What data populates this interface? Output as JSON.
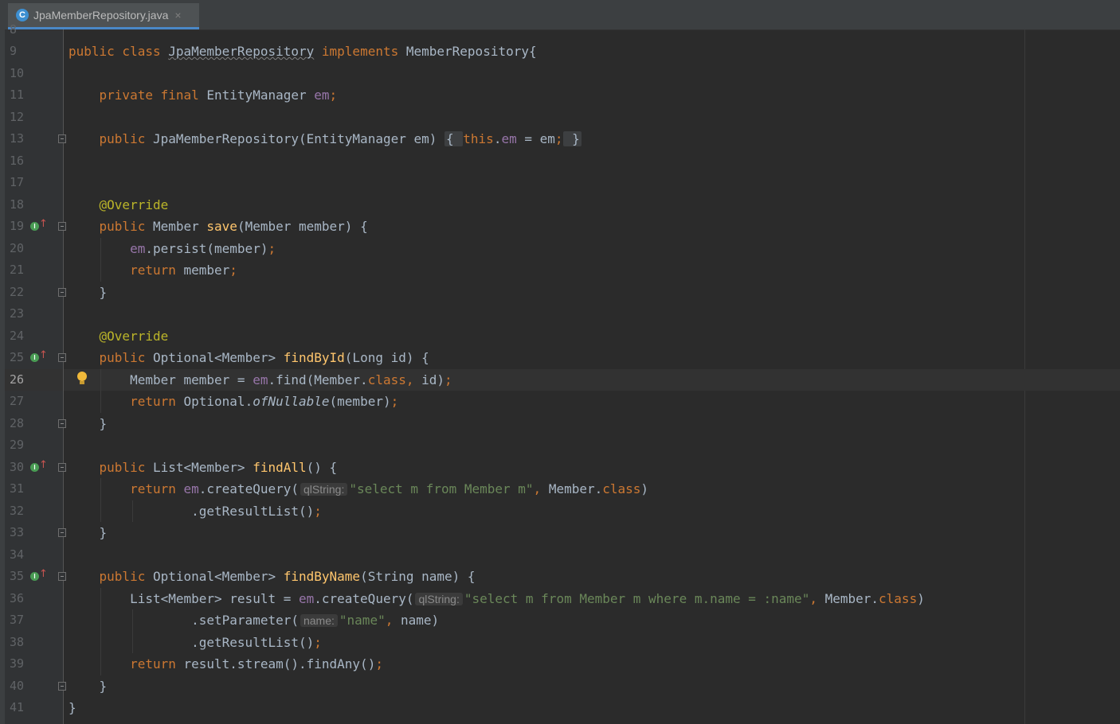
{
  "tab": {
    "icon_letter": "C",
    "file_name": "JpaMemberRepository.java",
    "close_glyph": "×"
  },
  "top_partial_line_number": "8",
  "lines": [
    {
      "n": "9",
      "segments": [
        [
          "kw",
          "public class "
        ],
        [
          "warn",
          "JpaMemberRepository"
        ],
        [
          "kw",
          " implements "
        ],
        [
          "d",
          "MemberRepository{"
        ]
      ]
    },
    {
      "n": "10",
      "segments": []
    },
    {
      "n": "11",
      "segments": [
        [
          "d",
          "    "
        ],
        [
          "kw",
          "private final "
        ],
        [
          "d",
          "EntityManager "
        ],
        [
          "fld",
          "em"
        ],
        [
          "kw",
          ";"
        ]
      ]
    },
    {
      "n": "12",
      "segments": []
    },
    {
      "n": "13",
      "segments": [
        [
          "d",
          "    "
        ],
        [
          "kw",
          "public "
        ],
        [
          "d",
          "JpaMemberRepository(EntityManager em) "
        ],
        [
          "fold",
          "{ "
        ],
        [
          "kw",
          "this"
        ],
        [
          "d",
          "."
        ],
        [
          "fld",
          "em"
        ],
        [
          "d",
          " = em"
        ],
        [
          "kw",
          ";"
        ],
        [
          "fold",
          " }"
        ]
      ]
    },
    {
      "n": "16",
      "segments": []
    },
    {
      "n": "17",
      "segments": []
    },
    {
      "n": "18",
      "segments": [
        [
          "d",
          "    "
        ],
        [
          "ann",
          "@Override"
        ]
      ]
    },
    {
      "n": "19",
      "segments": [
        [
          "d",
          "    "
        ],
        [
          "kw",
          "public "
        ],
        [
          "d",
          "Member "
        ],
        [
          "fn",
          "save"
        ],
        [
          "d",
          "(Member member) {"
        ]
      ]
    },
    {
      "n": "20",
      "segments": [
        [
          "d",
          "        "
        ],
        [
          "fld",
          "em"
        ],
        [
          "d",
          ".persist(member)"
        ],
        [
          "kw",
          ";"
        ]
      ]
    },
    {
      "n": "21",
      "segments": [
        [
          "d",
          "        "
        ],
        [
          "kw",
          "return "
        ],
        [
          "d",
          "member"
        ],
        [
          "kw",
          ";"
        ]
      ]
    },
    {
      "n": "22",
      "segments": [
        [
          "d",
          "    }"
        ]
      ]
    },
    {
      "n": "23",
      "segments": []
    },
    {
      "n": "24",
      "segments": [
        [
          "d",
          "    "
        ],
        [
          "ann",
          "@Override"
        ]
      ]
    },
    {
      "n": "25",
      "segments": [
        [
          "d",
          "    "
        ],
        [
          "kw",
          "public "
        ],
        [
          "d",
          "Optional<Member> "
        ],
        [
          "fn",
          "findById"
        ],
        [
          "d",
          "(Long id) {"
        ]
      ]
    },
    {
      "n": "26",
      "segments": [
        [
          "d",
          "        Member member = "
        ],
        [
          "fld",
          "em"
        ],
        [
          "d",
          ".find(Member."
        ],
        [
          "kw",
          "class, "
        ],
        [
          "d",
          "id)"
        ],
        [
          "kw",
          ";"
        ]
      ]
    },
    {
      "n": "27",
      "segments": [
        [
          "d",
          "        "
        ],
        [
          "kw",
          "return "
        ],
        [
          "d",
          "Optional."
        ],
        [
          "it",
          "ofNullable"
        ],
        [
          "d",
          "(member)"
        ],
        [
          "kw",
          ";"
        ]
      ]
    },
    {
      "n": "28",
      "segments": [
        [
          "d",
          "    }"
        ]
      ]
    },
    {
      "n": "29",
      "segments": []
    },
    {
      "n": "30",
      "segments": [
        [
          "d",
          "    "
        ],
        [
          "kw",
          "public "
        ],
        [
          "d",
          "List<Member> "
        ],
        [
          "fn",
          "findAll"
        ],
        [
          "d",
          "() {"
        ]
      ]
    },
    {
      "n": "31",
      "segments": [
        [
          "d",
          "        "
        ],
        [
          "kw",
          "return "
        ],
        [
          "fld",
          "em"
        ],
        [
          "d",
          ".createQuery("
        ],
        [
          "hint",
          "qlString:"
        ],
        [
          "str",
          "\"select m from Member m\""
        ],
        [
          "kw",
          ", "
        ],
        [
          "d",
          "Member."
        ],
        [
          "kw",
          "class"
        ],
        [
          "d",
          ")"
        ]
      ]
    },
    {
      "n": "32",
      "segments": [
        [
          "d",
          "                .getResultList()"
        ],
        [
          "kw",
          ";"
        ]
      ]
    },
    {
      "n": "33",
      "segments": [
        [
          "d",
          "    }"
        ]
      ]
    },
    {
      "n": "34",
      "segments": []
    },
    {
      "n": "35",
      "segments": [
        [
          "d",
          "    "
        ],
        [
          "kw",
          "public "
        ],
        [
          "d",
          "Optional<Member> "
        ],
        [
          "fn",
          "findByName"
        ],
        [
          "d",
          "(String name) {"
        ]
      ]
    },
    {
      "n": "36",
      "segments": [
        [
          "d",
          "        List<Member> result = "
        ],
        [
          "fld",
          "em"
        ],
        [
          "d",
          ".createQuery("
        ],
        [
          "hint",
          "qlString:"
        ],
        [
          "str",
          "\"select m from Member m where m.name = :name\""
        ],
        [
          "kw",
          ", "
        ],
        [
          "d",
          "Member."
        ],
        [
          "kw",
          "class"
        ],
        [
          "d",
          ")"
        ]
      ]
    },
    {
      "n": "37",
      "segments": [
        [
          "d",
          "                .setParameter("
        ],
        [
          "hint",
          "name:"
        ],
        [
          "str",
          "\"name\""
        ],
        [
          "kw",
          ", "
        ],
        [
          "d",
          "name)"
        ]
      ]
    },
    {
      "n": "38",
      "segments": [
        [
          "d",
          "                .getResultList()"
        ],
        [
          "kw",
          ";"
        ]
      ]
    },
    {
      "n": "39",
      "segments": [
        [
          "d",
          "        "
        ],
        [
          "kw",
          "return "
        ],
        [
          "d",
          "result.stream().findAny()"
        ],
        [
          "kw",
          ";"
        ]
      ]
    },
    {
      "n": "40",
      "segments": [
        [
          "d",
          "    }"
        ]
      ]
    },
    {
      "n": "41",
      "segments": [
        [
          "d",
          "}"
        ]
      ]
    }
  ],
  "current_line": "26",
  "implements_marker_lines": [
    "19",
    "25",
    "30",
    "35"
  ],
  "fold_marker_lines": [
    "13",
    "19",
    "22",
    "25",
    "28",
    "30",
    "33",
    "35",
    "40"
  ],
  "bulb_line": "26",
  "icons": {
    "implements": "implements-method-icon",
    "fold": "fold-marker-icon",
    "bulb": "lightbulb-icon"
  },
  "colors": {
    "keyword": "#cc7832",
    "field": "#9876aa",
    "method_decl": "#ffc66d",
    "annotation": "#bbb529",
    "string": "#6a8759",
    "default": "#a9b7c6",
    "background": "#2b2b2b"
  }
}
